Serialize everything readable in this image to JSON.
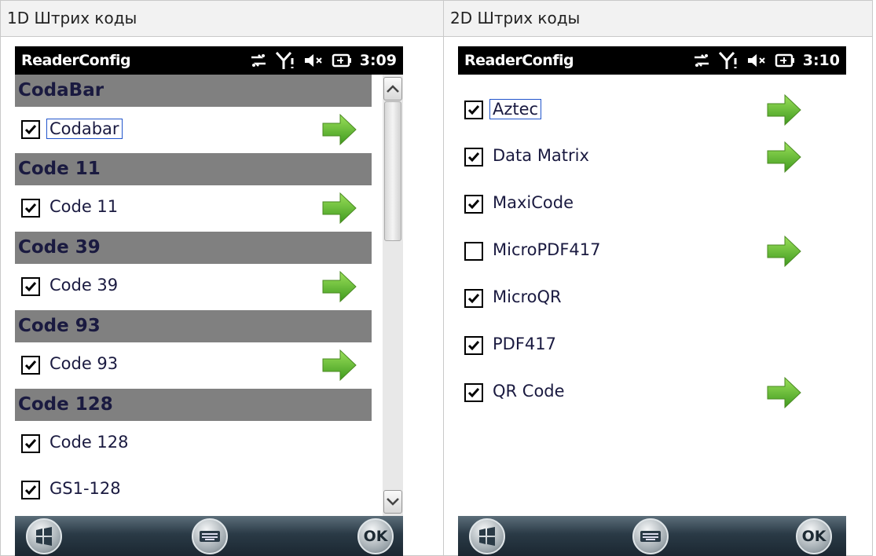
{
  "columns": [
    {
      "header": "1D Штрих коды",
      "app_title": "ReaderConfig",
      "time": "3:09",
      "sections": [
        {
          "title": "CodaBar",
          "items": [
            {
              "label": "Codabar",
              "checked": true,
              "arrow": true,
              "focused": true
            }
          ]
        },
        {
          "title": "Code 11",
          "items": [
            {
              "label": "Code 11",
              "checked": true,
              "arrow": true
            }
          ]
        },
        {
          "title": "Code 39",
          "items": [
            {
              "label": "Code 39",
              "checked": true,
              "arrow": true
            }
          ]
        },
        {
          "title": "Code 93",
          "items": [
            {
              "label": "Code 93",
              "checked": true,
              "arrow": true
            }
          ]
        },
        {
          "title": "Code 128",
          "items": [
            {
              "label": "Code 128",
              "checked": true,
              "arrow": false
            },
            {
              "label": "GS1-128",
              "checked": true,
              "arrow": false
            }
          ]
        }
      ]
    },
    {
      "header": "2D Штрих коды",
      "app_title": "ReaderConfig",
      "time": "3:10",
      "items": [
        {
          "label": "Aztec",
          "checked": true,
          "arrow": true,
          "focused": true
        },
        {
          "label": "Data Matrix",
          "checked": true,
          "arrow": true
        },
        {
          "label": "MaxiCode",
          "checked": true,
          "arrow": false
        },
        {
          "label": "MicroPDF417",
          "checked": false,
          "arrow": true
        },
        {
          "label": "MicroQR",
          "checked": true,
          "arrow": false
        },
        {
          "label": "PDF417",
          "checked": true,
          "arrow": false
        },
        {
          "label": "QR Code",
          "checked": true,
          "arrow": true
        }
      ]
    }
  ],
  "softkeys": {
    "ok_label": "OK",
    "start_icon": "windows-start-icon",
    "keyboard_icon": "keyboard-icon"
  },
  "colors": {
    "section_bg": "#808080",
    "text": "#1a1a40",
    "arrow_green": "#66bb33"
  }
}
